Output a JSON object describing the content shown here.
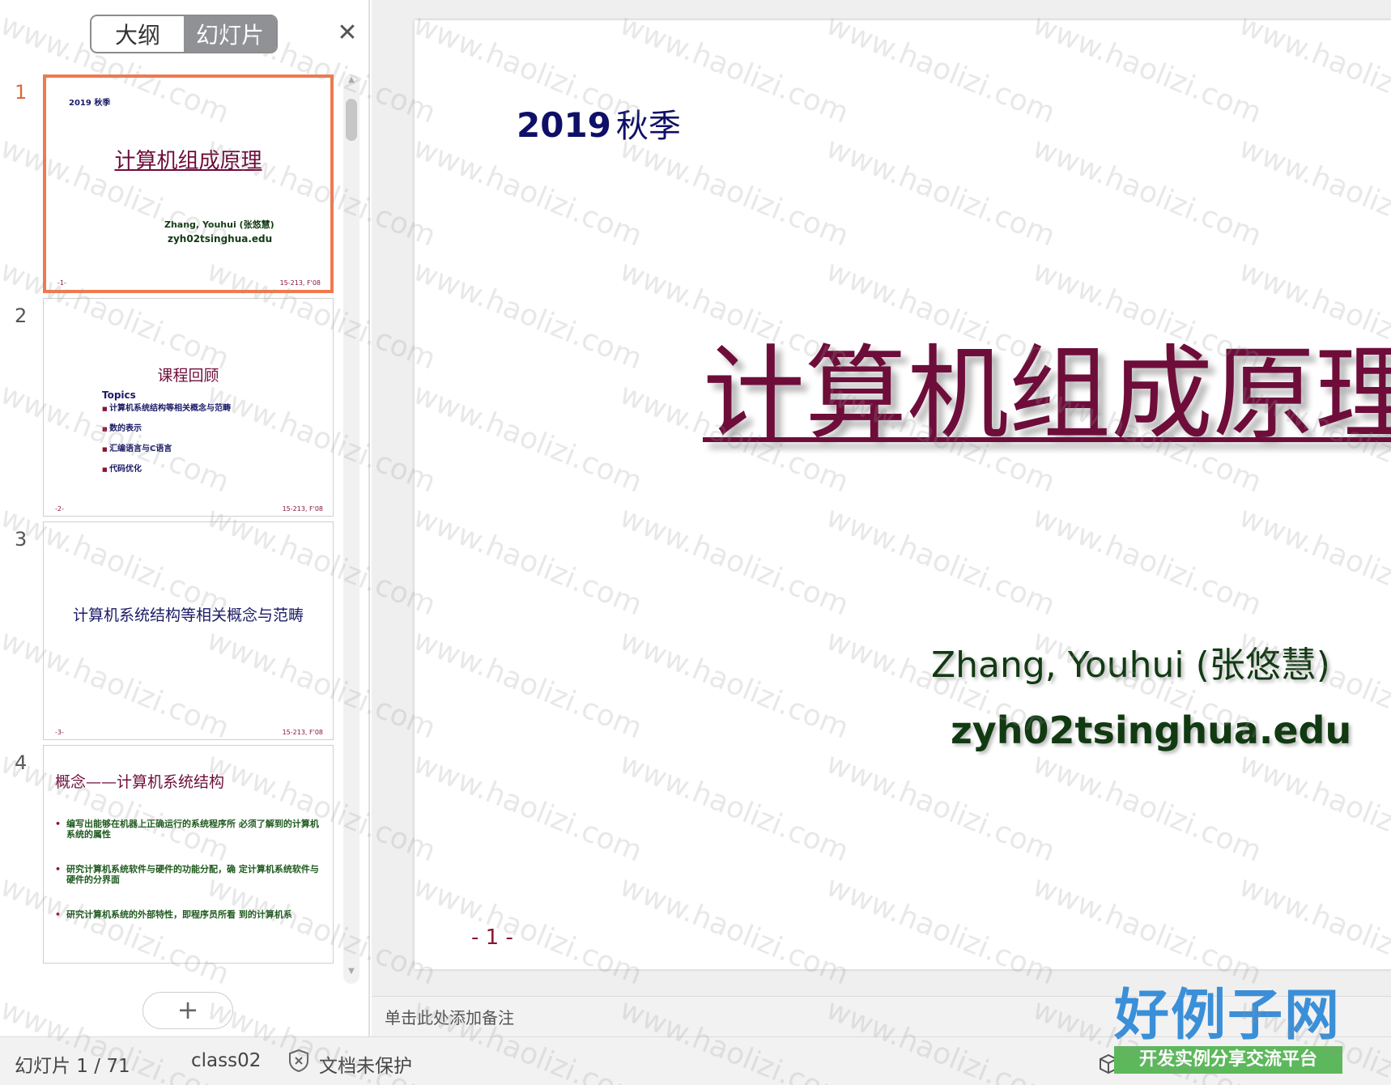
{
  "sidebar": {
    "tabs": [
      {
        "label": "大纲",
        "active": false
      },
      {
        "label": "幻灯片",
        "active": true
      }
    ],
    "close_icon": "close-icon",
    "add_button": "+",
    "thumbnails": [
      {
        "number": "1",
        "selected": true,
        "year": "2019 秋季",
        "title": "计算机组成原理",
        "author": "Zhang, Youhui (张悠慧)",
        "email": "zyh02tsinghua.edu",
        "footer_left": "-1-",
        "footer_right": "15-213, F'08"
      },
      {
        "number": "2",
        "selected": false,
        "title": "课程回顾",
        "topics_label": "Topics",
        "items": [
          "计算机系统结构等相关概念与范畴",
          "数的表示",
          "汇编语言与C语言",
          "代码优化"
        ],
        "footer_left": "-2-",
        "footer_right": "15-213, F'08"
      },
      {
        "number": "3",
        "selected": false,
        "title": "计算机系统结构等相关概念与范畴",
        "footer_left": "-3-",
        "footer_right": "15-213, F'08"
      },
      {
        "number": "4",
        "selected": false,
        "title": "概念——计算机系统结构",
        "items": [
          "编写出能够在机器上正确运行的系统程序所 必须了解到的计算机系统的属性",
          "研究计算机系统软件与硬件的功能分配，确 定计算机系统软件与硬件的分界面",
          "研究计算机系统的外部特性，即程序员所看 到的计算机系"
        ]
      }
    ]
  },
  "slide": {
    "year": "2019",
    "season": "秋季",
    "title": "计算机组成原理",
    "author": "Zhang, Youhui (张悠慧)",
    "email": "zyh02tsinghua.edu",
    "page": "- 1 -"
  },
  "notes": {
    "placeholder": "单击此处添加备注"
  },
  "status": {
    "slide_counter": "幻灯片 1 / 71",
    "doc_name": "class02",
    "protection": "文档未保护"
  },
  "brand": {
    "title": "好例子网",
    "subtitle": "开发实例分享交流平台"
  },
  "watermark": {
    "text": "www.haolizi.com"
  },
  "colors": {
    "selected_border": "#f07a4d",
    "title_maroon": "#6e0d3a",
    "navy": "#0f0f68",
    "green": "#123a12"
  }
}
